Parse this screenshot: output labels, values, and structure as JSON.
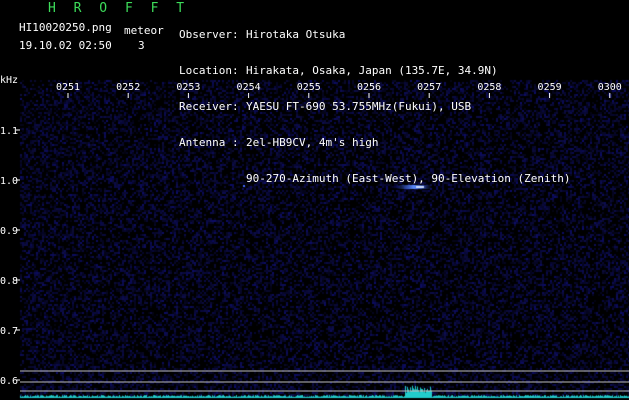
{
  "app": {
    "title": "H R O F F T",
    "filename": "HI10020250.png",
    "datetime": "19.10.02 02:50",
    "meteor_label": "meteor",
    "meteor_count": "3"
  },
  "info": [
    {
      "key": "Observer",
      "sep": ":",
      "value": "Hirotaka Otsuka"
    },
    {
      "key": "Location",
      "sep": ":",
      "value": "Hirakata, Osaka, Japan (135.7E, 34.9N)"
    },
    {
      "key": "Receiver",
      "sep": ":",
      "value": "YAESU FT-690 53.755MHz(Fukui), USB"
    },
    {
      "key": "Antenna",
      "sep": ":",
      "value": "2el-HB9CV, 4m's high"
    },
    {
      "key": "",
      "sep": "",
      "value": "90-270-Azimuth (East-West), 90-Elevation (Zenith)"
    }
  ],
  "spectrogram": {
    "y_unit": "kHz",
    "x_ticks": [
      "0251",
      "0252",
      "0253",
      "0254",
      "0255",
      "0256",
      "0257",
      "0258",
      "0259",
      "0300"
    ],
    "y_ticks": [
      "1.1",
      "1.0",
      "0.9",
      "0.8",
      "0.7",
      "0.6"
    ],
    "colors": {
      "background": "#000000",
      "noise": "#0a0a55",
      "echo": "#5b8cff",
      "tick": "#ffffff",
      "baseline": "#bbbbbb",
      "signal_trace": "#22cccc"
    }
  }
}
